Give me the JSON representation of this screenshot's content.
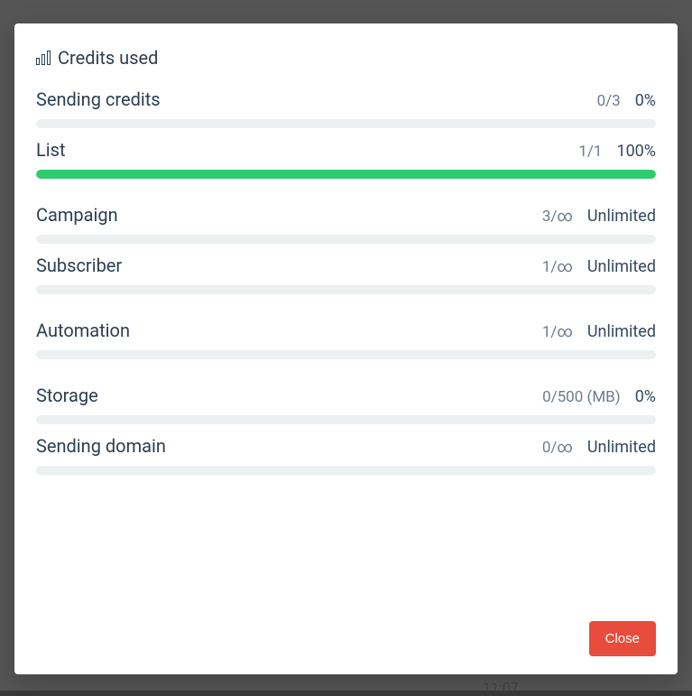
{
  "modal": {
    "title": "Credits used",
    "close_label": "Close"
  },
  "metrics": [
    {
      "label": "Sending credits",
      "fraction": "0/3",
      "pct": "0%",
      "fill": 0
    },
    {
      "label": "List",
      "fraction": "1/1",
      "pct": "100%",
      "fill": 100
    },
    {
      "label": "Campaign",
      "fraction": "3/∞",
      "pct": "Unlimited",
      "fill": 0
    },
    {
      "label": "Subscriber",
      "fraction": "1/∞",
      "pct": "Unlimited",
      "fill": 0
    },
    {
      "label": "Automation",
      "fraction": "1/∞",
      "pct": "Unlimited",
      "fill": 0
    },
    {
      "label": "Storage",
      "fraction": "0/500 (MB)",
      "pct": "0%",
      "fill": 0
    },
    {
      "label": "Sending domain",
      "fraction": "0/∞",
      "pct": "Unlimited",
      "fill": 0
    }
  ],
  "groups": [
    [
      0,
      1
    ],
    [
      2,
      3
    ],
    [
      4
    ],
    [
      5,
      6
    ]
  ],
  "bg_time": "11:07"
}
